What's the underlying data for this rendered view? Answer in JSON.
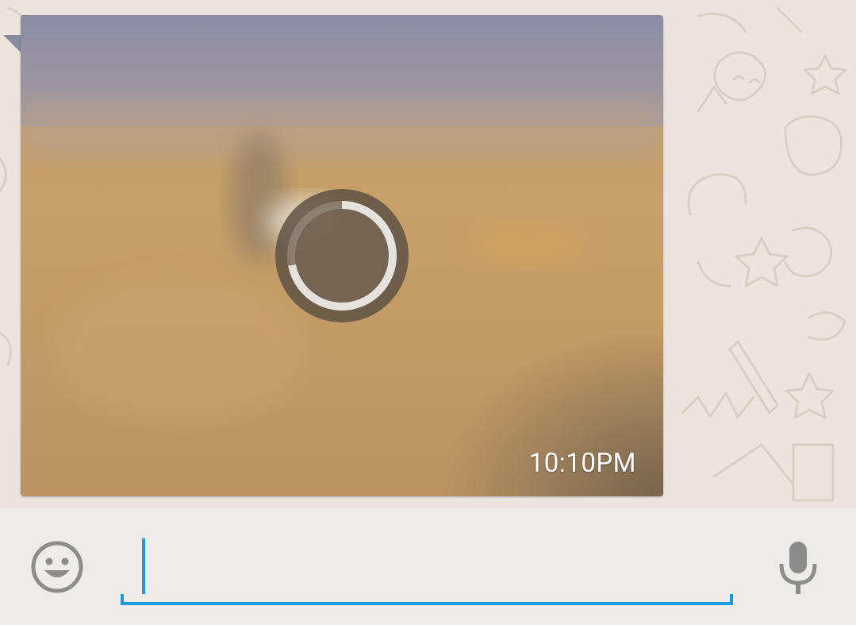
{
  "chat": {
    "message": {
      "type": "video",
      "timestamp": "10:10PM",
      "download_progress": 0.72
    }
  },
  "composer": {
    "input_value": "",
    "input_placeholder": "",
    "emoji_icon": "smiley-face-icon",
    "mic_icon": "microphone-icon"
  },
  "colors": {
    "accent": "#1a9be0",
    "wallpaper": "#ece5dd",
    "input_bar": "#eeece9",
    "icon_gray": "#8c8c8c"
  }
}
